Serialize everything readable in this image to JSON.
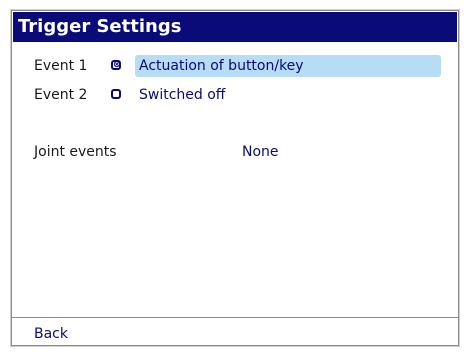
{
  "window": {
    "title": "Trigger Settings"
  },
  "events": [
    {
      "label": "Event 1",
      "checkbox_state": "checked",
      "checkbox_glyph": "⊗",
      "value": "Actuation of button/key",
      "selected": true
    },
    {
      "label": "Event 2",
      "checkbox_state": "unchecked",
      "checkbox_glyph": "",
      "value": "Switched off",
      "selected": false
    }
  ],
  "joint_events": {
    "label": "Joint events",
    "value": "None"
  },
  "footer": {
    "back_label": "Back"
  },
  "colors": {
    "titlebar_bg": "#0a0a78",
    "accent_text": "#0a0a78",
    "selection_bg": "#b7dcf5"
  }
}
